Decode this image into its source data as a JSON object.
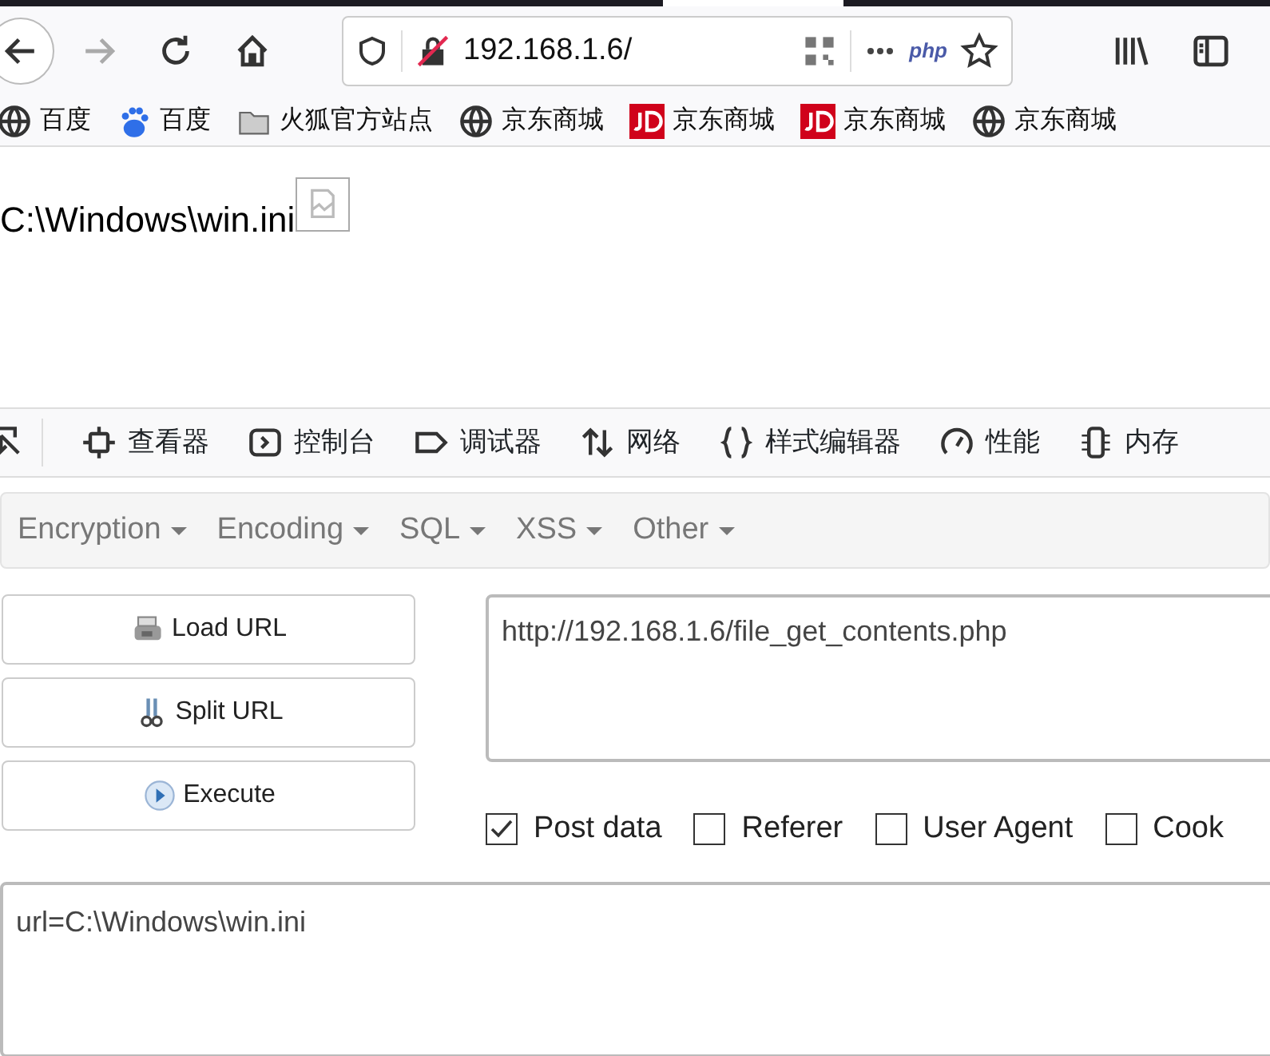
{
  "toolbar": {
    "nav_buttons": [
      {
        "kind": "back",
        "disabled": false
      },
      {
        "kind": "forward",
        "disabled": true
      },
      {
        "kind": "reload",
        "disabled": false
      },
      {
        "kind": "home",
        "disabled": false
      }
    ],
    "address": "192.168.1.6/",
    "page_action": "php"
  },
  "bookmarks": [
    {
      "label": "百度",
      "kind": "globe"
    },
    {
      "label": "百度",
      "kind": "baidu"
    },
    {
      "label": "火狐官方站点",
      "kind": "folder"
    },
    {
      "label": "京东商城",
      "kind": "globe"
    },
    {
      "label": "京东商城",
      "kind": "jd"
    },
    {
      "label": "京东商城",
      "kind": "jd"
    },
    {
      "label": "京东商城",
      "kind": "globe"
    }
  ],
  "page": {
    "text": "C:\\Windows\\win.ini"
  },
  "devtools_tabs": [
    {
      "label": "查看器",
      "kind": "inspector"
    },
    {
      "label": "控制台",
      "kind": "console"
    },
    {
      "label": "调试器",
      "kind": "debugger"
    },
    {
      "label": "网络",
      "kind": "network"
    },
    {
      "label": "样式编辑器",
      "kind": "style"
    },
    {
      "label": "性能",
      "kind": "performance"
    },
    {
      "label": "内存",
      "kind": "memory"
    }
  ],
  "hackbar": {
    "menus": [
      "Encryption",
      "Encoding",
      "SQL",
      "XSS",
      "Other"
    ],
    "buttons": [
      {
        "label": "Load URL",
        "kind": "load"
      },
      {
        "label": "Split URL",
        "kind": "split"
      },
      {
        "label": "Execute",
        "kind": "execute"
      }
    ],
    "url": "http://192.168.1.6/file_get_contents.php",
    "options": [
      {
        "label": "Post data",
        "checked": true
      },
      {
        "label": "Referer",
        "checked": false
      },
      {
        "label": "User Agent",
        "checked": false
      },
      {
        "label": "Cook",
        "checked": false
      }
    ],
    "post_data": "url=C:\\Windows\\win.ini"
  }
}
